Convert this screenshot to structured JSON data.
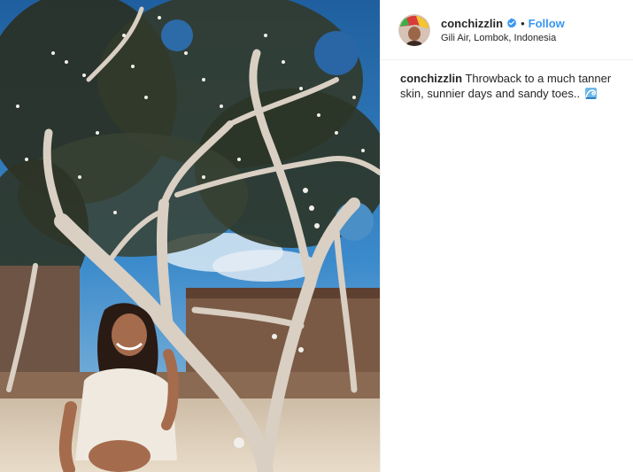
{
  "post": {
    "username": "conchizzlin",
    "follow_label": "Follow",
    "separator": "•",
    "location": "Gili Air, Lombok, Indonesia",
    "caption": {
      "username": "conchizzlin",
      "text": "Throwback to a much tanner skin, sunnier days and sandy toes.."
    }
  },
  "icons": {
    "verified": "verified-badge-icon",
    "emoji": "water-wave-emoji-icon"
  },
  "colors": {
    "follow": "#3897f0",
    "verified": "#3897f0",
    "text": "#262626"
  }
}
